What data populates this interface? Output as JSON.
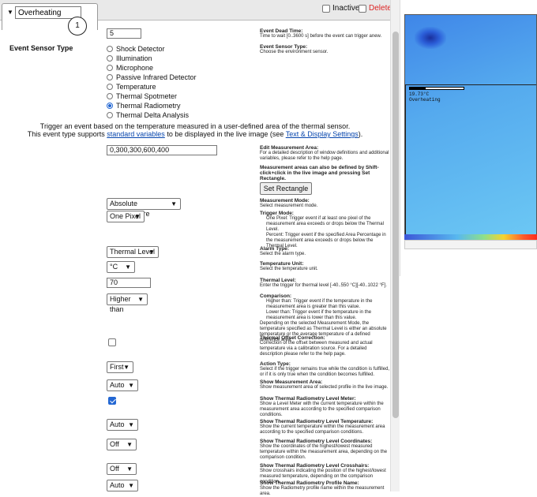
{
  "tab": {
    "name": "Overheating",
    "arrow": "▼"
  },
  "badge": "1",
  "header": {
    "inactive_label": "Inactive",
    "delete_label": "Delete"
  },
  "dead_time": {
    "value": "5",
    "title": "Event Dead Time:",
    "desc": "Time to wait [0..3600 s] before the event can trigger anew."
  },
  "sensor_type": {
    "label": "Event Sensor Type",
    "title": "Event Sensor Type:",
    "desc": "Choose the environment sensor.",
    "options": [
      "Shock Detector",
      "Illumination",
      "Microphone",
      "Passive Infrared Detector",
      "Temperature",
      "Thermal Spotmeter",
      "Thermal Radiometry",
      "Thermal Delta Analysis"
    ],
    "selected": "Thermal Radiometry"
  },
  "intro": {
    "line1": "Trigger an event based on the temperature measured in a user-defined area of the thermal sensor.",
    "line2_prefix": "This event type supports ",
    "link1": "standard variables",
    "line2_mid": " to be displayed in the live image (see ",
    "link2": "Text & Display Settings",
    "line2_suffix": ")."
  },
  "measurement_area": {
    "value": "0,300,300,600,400",
    "title": "Edit Measurement Area:",
    "desc": "For a detailed description of window definitions and additional variables, please refer to the help page.",
    "note": "Measurement areas can also be defined by Shift-click+click in the live image and pressing Set Rectangle.",
    "button": "Set Rectangle"
  },
  "measurement_mode": {
    "value": "Absolute Temperature",
    "title": "Measurement Mode:",
    "desc": "Select measurement mode."
  },
  "trigger_mode": {
    "value": "One Pixel",
    "title": "Trigger Mode:",
    "bullets": [
      "One Pixel: Trigger event if at least one pixel of the measurement area exceeds or drops below the Thermal Level.",
      "Percent: Trigger event if the specified Area Percentage in the measurement area exceeds or drops below the Thermal Level."
    ]
  },
  "alarm_type": {
    "value": "Thermal Level",
    "title": "Alarm Type:",
    "desc": "Select the alarm type."
  },
  "temp_unit": {
    "value": "°C",
    "title": "Temperature Unit:",
    "desc": "Select the temperature unit."
  },
  "thermal_level": {
    "value": "70",
    "title": "Thermal Level:",
    "desc": "Enter the trigger for thermal level [-40..550 °C][-40..1022 °F]."
  },
  "comparison": {
    "value": "Higher than",
    "title": "Comparison:",
    "bullets": [
      "Higher than: Trigger event if the temperature in the measurement area is greater than this value.",
      "Lower than: Trigger event if the temperature in the measurement area is lower than this value."
    ],
    "desc": "Depending on the selected Measurement Mode, the temperature specified as Thermal Level is either an absolute temperature or the average temperature of a defined reference area."
  },
  "offset": {
    "title": "Thermal Offset Correction:",
    "desc": "Correction of the offset between measured and actual temperature via a calibration source. For a detailed description please refer to the help page."
  },
  "action_type": {
    "value": "First",
    "title": "Action Type:",
    "desc": "Select if the trigger remains true while the condition is fulfilled, or if it is only true when the condition becomes fulfilled."
  },
  "show_area": {
    "value": "Auto",
    "title": "Show Measurement Area:",
    "desc": "Show measurement area of selected profile in the live image."
  },
  "level_meter": {
    "title": "Show Thermal Radiometry Level Meter:",
    "desc": "Show a Level Meter with the current temperature within the measurement area according to the specified comparison conditions."
  },
  "level_temp": {
    "value": "Auto",
    "title": "Show Thermal Radiometry Level Temperature:",
    "desc": "Show the current temperature within the measurement area according to the specified comparison conditions."
  },
  "level_coords": {
    "value": "Off",
    "title": "Show Thermal Radiometry Level Coordinates:",
    "desc": "Show the coordinates of the highest/lowest measured temperature within the measurement area, depending on the comparison condition."
  },
  "crosshairs": {
    "value": "Off",
    "title": "Show Thermal Radiometry Level Crosshairs:",
    "desc": "Show crosshairs indicating the position of the highest/lowest measured temperature, depending on the comparison condition."
  },
  "profile_name": {
    "value": "Auto",
    "title": "Show Thermal Radiometry Profile Name:",
    "desc": "Show the Radiometry profile name within the measurement area."
  },
  "help_link": "help page",
  "live": {
    "temp": "19.73°C",
    "name": "Overheating",
    "level_meter_fill": 0.3
  },
  "colors": {
    "accent": "#2367d3",
    "delete": "#dd2222",
    "link": "#0645ad"
  }
}
